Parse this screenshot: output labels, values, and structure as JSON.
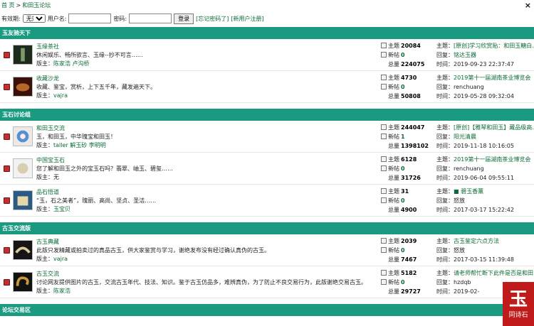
{
  "topbar": {
    "home": "首 页",
    "sep": ">",
    "forum": "和田玉论坛",
    "close": "×"
  },
  "login": {
    "validity_label": "有效期:",
    "validity_value": "无效",
    "username_label": "用户名:",
    "password_label": "密码:",
    "login_button": "登录",
    "forgot": "[忘记密码了]",
    "register": "[新用户注册]"
  },
  "categories": [
    {
      "name": "玉友驰天下",
      "forums": [
        {
          "title": "玉缘茶社",
          "desc": "休闲娱乐、畅所欲言、玉缘--抄不可言……",
          "mod_label": "版主：",
          "mods": "陈家浩 卢沟桥",
          "topics_label": "主题",
          "topics": "20084",
          "new_label": "新帖",
          "new": "0",
          "total_label": "总量",
          "total": "224075",
          "last_topic_label": "主题：",
          "last_topic": "[原创]学习欣赏贴：和田玉糖白…",
          "reply_label": "回复：",
          "reply": "铭达玉器",
          "time_label": "时间：",
          "time": "2019-09-23 22:37:47"
        },
        {
          "title": "收藏沙龙",
          "desc": "收藏、鉴宝，赏析，上下五千年，藏发遍天下。",
          "mod_label": "版主：",
          "mods": "vajra",
          "topics_label": "主题",
          "topics": "4730",
          "new_label": "新帖",
          "new": "0",
          "total_label": "总量",
          "total": "50808",
          "last_topic_label": "主题：",
          "last_topic": "2019第十一届湖南茶业博览会",
          "reply_label": "回复：",
          "reply": "renchuang",
          "time_label": "时间：",
          "time": "2019-05-28 09:32:04"
        }
      ]
    },
    {
      "name": "玉石讨论组",
      "forums": [
        {
          "title": "和田玉交流",
          "desc": "玉，和田玉，中华瑰宝和田玉！",
          "mod_label": "版主：",
          "mods": "taller 解玉砂 李明明",
          "topics_label": "主题",
          "topics": "244047",
          "new_label": "新帖",
          "new": "1",
          "total_label": "总量",
          "total": "1398102",
          "last_topic_label": "主题：",
          "last_topic": "[原创]【雅琴和田玉】藏品级高…",
          "reply_label": "回复：",
          "reply": "阳光清晨",
          "time_label": "时间：",
          "time": "2019-11-18 10:16:05"
        },
        {
          "title": "中国宝玉石",
          "desc": "您了解和田玉之外的宝玉石吗？翡翠、岫玉、碧玺……",
          "mod_label": "版主：",
          "mods": "无",
          "topics_label": "主题",
          "topics": "6128",
          "new_label": "新帖",
          "new": "0",
          "total_label": "总量",
          "total": "31726",
          "last_topic_label": "主题：",
          "last_topic": "2019第十一届湖南茶业博览会",
          "reply_label": "回复：",
          "reply": "renchuang",
          "time_label": "时间：",
          "time": "2019-06-04 09:55:11"
        },
        {
          "title": "品石悟道",
          "desc": "“玉，石之美者”，瑰丽、高尚、坚贞、圣洁……",
          "mod_label": "版主：",
          "mods": "玉宝贝",
          "topics_label": "主题",
          "topics": "31",
          "new_label": "新帖",
          "new": "0",
          "total_label": "总量",
          "total": "4900",
          "last_topic_label": "主题：",
          "last_topic": "■ 碧玉香薰",
          "reply_label": "回复：",
          "reply": "怒放",
          "time_label": "时间：",
          "time": "2017-03-17 15:22:42"
        }
      ]
    },
    {
      "name": "古玉交流版",
      "forums": [
        {
          "title": "古玉典藏",
          "desc": "此版只发精藏或拍卖过的真品古玉，供大家鉴赏与学习，谢绝发布没有经过确认真伪的古玉。",
          "mod_label": "版主：",
          "mods": "vajra",
          "topics_label": "主题",
          "topics": "2039",
          "new_label": "新帖",
          "new": "0",
          "total_label": "总量",
          "total": "7467",
          "last_topic_label": "主题：",
          "last_topic": "古玉鉴定六点方法",
          "reply_label": "回复：",
          "reply": "怒放",
          "time_label": "时间：",
          "time": "2017-03-15 11:39:48"
        },
        {
          "title": "古玉交流",
          "desc": "讨论网友提供图片的古玉，交流古玉年代、技法、知识。鉴于古玉仿品多，难辨真伪，为了防止不良交易行为，此版谢绝交易古玉。",
          "mod_label": "版主：",
          "mods": "陈家浩",
          "topics_label": "主题",
          "topics": "5182",
          "new_label": "新帖",
          "new": "0",
          "total_label": "总量",
          "total": "29727",
          "last_topic_label": "主题：",
          "last_topic": "请老师帮忙断下此件是否是和田",
          "reply_label": "回复：",
          "reply": "hzdqb",
          "time_label": "时间：",
          "time": "2019-02-"
        }
      ]
    },
    {
      "name": "论坛交易区",
      "forums": []
    }
  ],
  "watermark": {
    "big": "玉",
    "small": "同诗石"
  },
  "colors": {
    "category_bg": "#1a9a81",
    "link": "#0b6b34",
    "book_icon": "#c03030"
  }
}
